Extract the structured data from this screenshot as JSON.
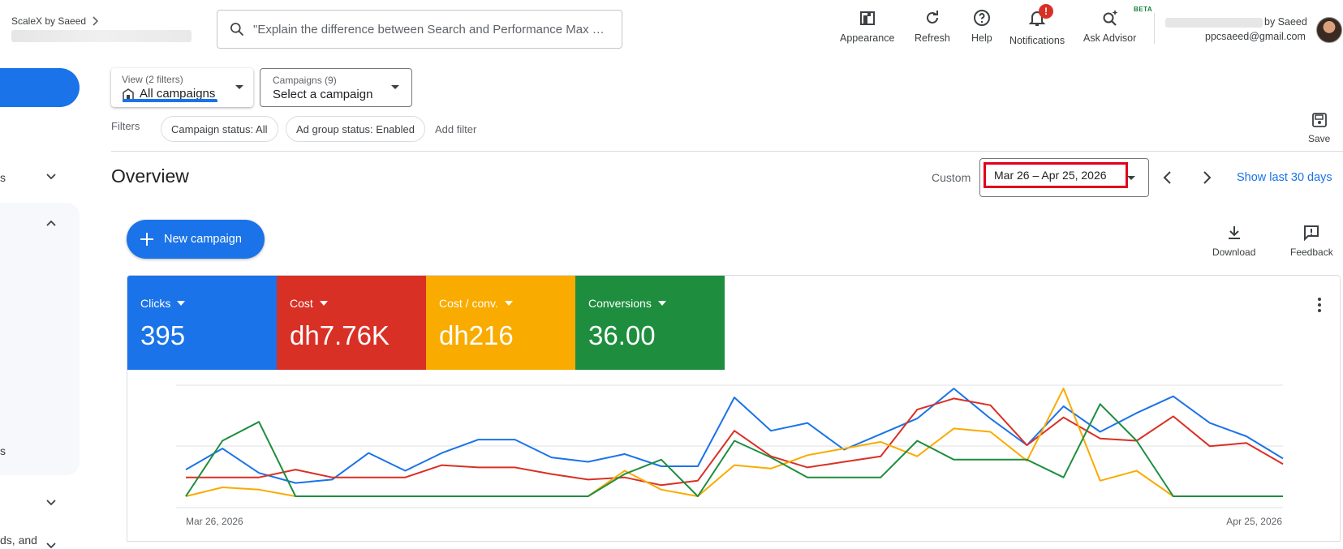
{
  "account": {
    "name": "ScaleX by Saeed"
  },
  "search": {
    "placeholder": "\"Explain the difference between Search and Performance Max cam…"
  },
  "top_actions": {
    "appearance": "Appearance",
    "refresh": "Refresh",
    "help": "Help",
    "notifications": "Notifications",
    "notifications_badge": "!",
    "ask_advisor": "Ask Advisor",
    "beta": "BETA"
  },
  "user": {
    "name_suffix": "by Saeed",
    "email": "ppcsaeed@gmail.com"
  },
  "left_nav": {
    "item_a": "s",
    "item_b": "s",
    "item_c": "ds, and"
  },
  "view_select": {
    "label": "View (2 filters)",
    "value": "All campaigns"
  },
  "campaign_select": {
    "label": "Campaigns (9)",
    "value": "Select a campaign"
  },
  "filters": {
    "label": "Filters",
    "chips": [
      "Campaign status: All",
      "Ad group status: Enabled"
    ],
    "add": "Add filter",
    "save": "Save"
  },
  "overview": {
    "title": "Overview",
    "custom_label": "Custom",
    "date_range": "Mar 26 – Apr 25, 2026",
    "show_last": "Show last 30 days"
  },
  "actions": {
    "new_campaign": "New campaign",
    "download": "Download",
    "feedback": "Feedback"
  },
  "colors": {
    "clicks": "#1a73e8",
    "cost": "#d93025",
    "cost_conv": "#f9ab00",
    "conversions": "#1e8e3e"
  },
  "metrics": [
    {
      "label": "Clicks",
      "value": "395"
    },
    {
      "label": "Cost",
      "value": "dh7.76K"
    },
    {
      "label": "Cost / conv.",
      "value": "dh216"
    },
    {
      "label": "Conversions",
      "value": "36.00"
    }
  ],
  "chart_data": {
    "type": "line",
    "x_start_label": "Mar 26, 2026",
    "x_end_label": "Apr 25, 2026",
    "grid": true,
    "series": [
      {
        "name": "Clicks",
        "color": "#1a73e8",
        "values": [
          0.24,
          0.43,
          0.21,
          0.12,
          0.15,
          0.39,
          0.23,
          0.39,
          0.51,
          0.51,
          0.35,
          0.31,
          0.38,
          0.27,
          0.27,
          0.89,
          0.59,
          0.66,
          0.42,
          0.56,
          0.7,
          0.97,
          0.7,
          0.46,
          0.81,
          0.58,
          0.75,
          0.9,
          0.66,
          0.54,
          0.34
        ]
      },
      {
        "name": "Cost",
        "color": "#d93025",
        "values": [
          0.17,
          0.17,
          0.17,
          0.24,
          0.17,
          0.17,
          0.17,
          0.28,
          0.26,
          0.26,
          0.2,
          0.15,
          0.17,
          0.1,
          0.14,
          0.59,
          0.36,
          0.26,
          0.31,
          0.36,
          0.78,
          0.88,
          0.82,
          0.46,
          0.71,
          0.52,
          0.5,
          0.72,
          0.45,
          0.48,
          0.29
        ]
      },
      {
        "name": "Cost / conv.",
        "color": "#f9ab00",
        "values": [
          0.0,
          0.08,
          0.06,
          0.0,
          0.0,
          0.0,
          0.0,
          0.0,
          0.0,
          0.0,
          0.0,
          0.0,
          0.23,
          0.06,
          0.0,
          0.28,
          0.25,
          0.37,
          0.43,
          0.49,
          0.36,
          0.61,
          0.58,
          0.32,
          0.97,
          0.14,
          0.23,
          0.0,
          0.0,
          0.0,
          0.0
        ]
      },
      {
        "name": "Conversions",
        "color": "#1e8e3e",
        "values": [
          0.0,
          0.5,
          0.67,
          0.0,
          0.0,
          0.0,
          0.0,
          0.0,
          0.0,
          0.0,
          0.0,
          0.0,
          0.2,
          0.33,
          0.0,
          0.5,
          0.35,
          0.17,
          0.17,
          0.17,
          0.5,
          0.33,
          0.33,
          0.33,
          0.17,
          0.83,
          0.5,
          0.0,
          0.0,
          0.0,
          0.0
        ]
      }
    ]
  }
}
